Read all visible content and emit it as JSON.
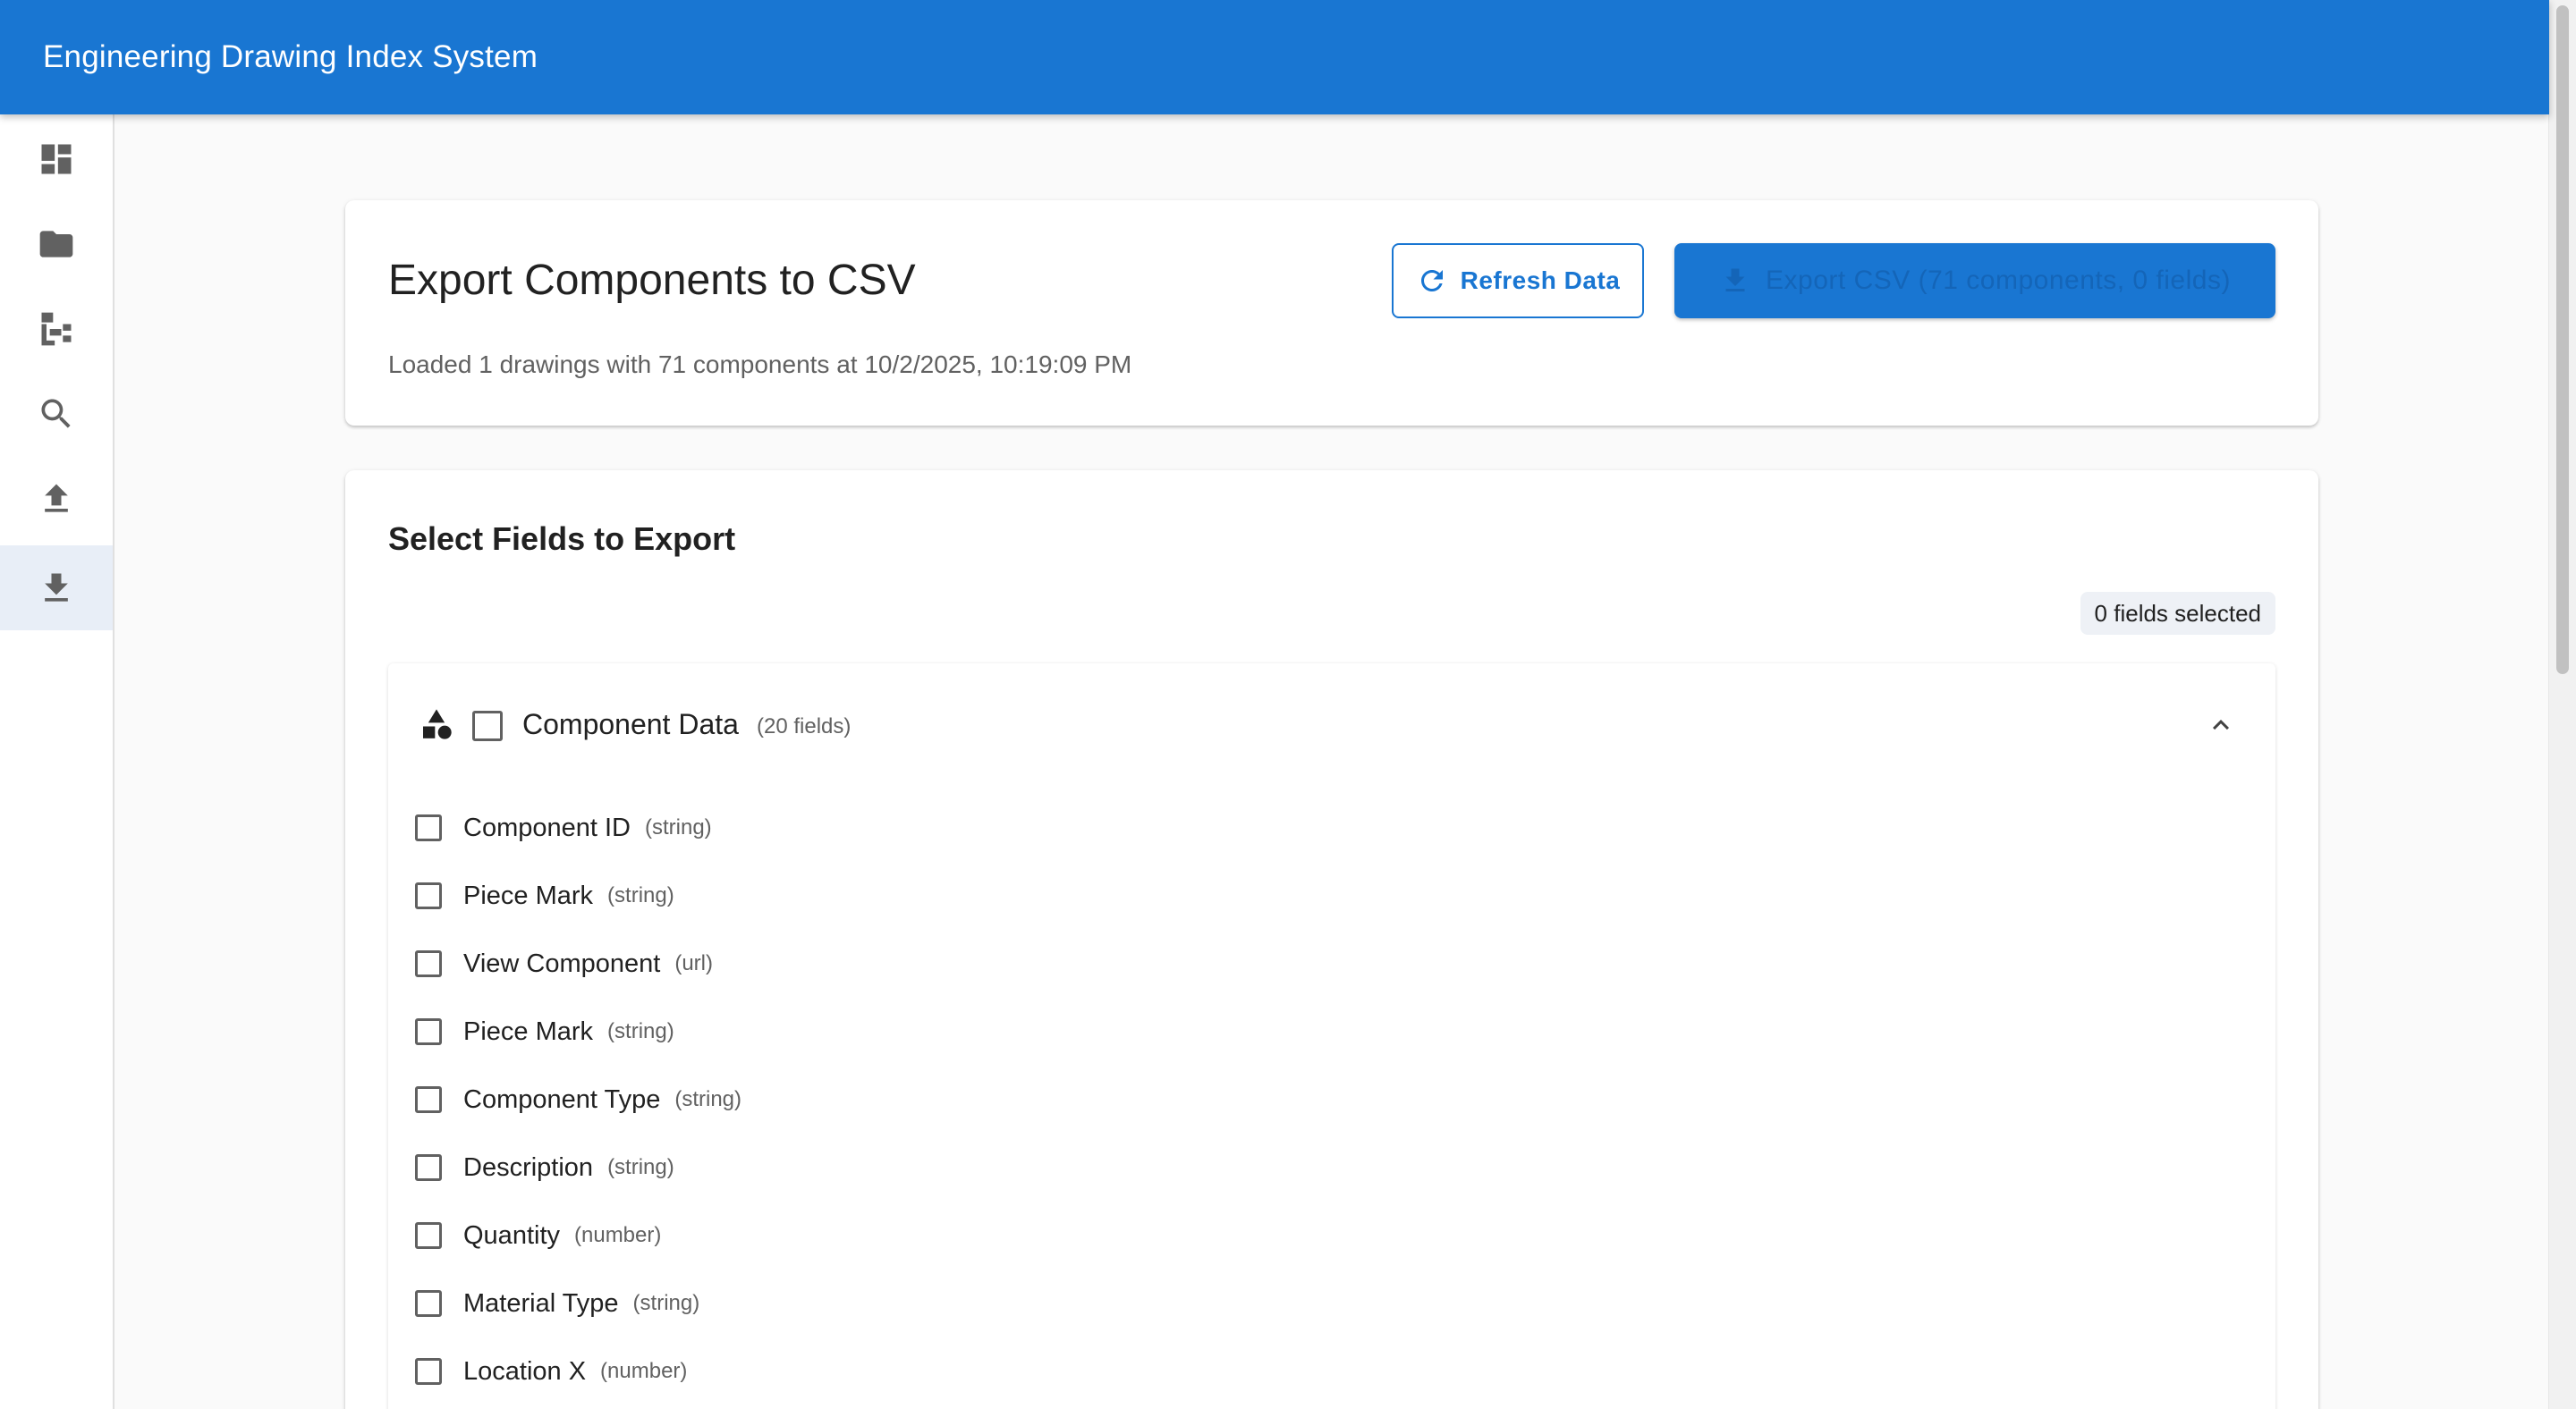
{
  "app": {
    "title": "Engineering Drawing Index System"
  },
  "sidebar": {
    "items": [
      {
        "icon": "dashboard-icon",
        "active": false
      },
      {
        "icon": "folder-icon",
        "active": false
      },
      {
        "icon": "hierarchy-icon",
        "active": false
      },
      {
        "icon": "search-icon",
        "active": false
      },
      {
        "icon": "upload-icon",
        "active": false
      },
      {
        "icon": "download-icon",
        "active": true
      }
    ]
  },
  "export_header": {
    "title": "Export Components to CSV",
    "status": "Loaded 1 drawings with 71 components at 10/2/2025, 10:19:09 PM",
    "refresh_label": "Refresh Data",
    "export_label": "Export CSV (71 components, 0 fields)"
  },
  "field_selection": {
    "title": "Select Fields to Export",
    "selected_count_label": "0 fields selected",
    "group": {
      "title": "Component Data",
      "count_label": "(20 fields)",
      "checked": false,
      "expanded": true,
      "fields": [
        {
          "name": "Component ID",
          "type": "(string)",
          "checked": false
        },
        {
          "name": "Piece Mark",
          "type": "(string)",
          "checked": false
        },
        {
          "name": "View Component",
          "type": "(url)",
          "checked": false
        },
        {
          "name": "Piece Mark",
          "type": "(string)",
          "checked": false
        },
        {
          "name": "Component Type",
          "type": "(string)",
          "checked": false
        },
        {
          "name": "Description",
          "type": "(string)",
          "checked": false
        },
        {
          "name": "Quantity",
          "type": "(number)",
          "checked": false
        },
        {
          "name": "Material Type",
          "type": "(string)",
          "checked": false
        },
        {
          "name": "Location X",
          "type": "(number)",
          "checked": false
        }
      ]
    }
  },
  "colors": {
    "primary": "#1976d2",
    "background": "#fafafa",
    "active_nav": "#e8eef7"
  }
}
